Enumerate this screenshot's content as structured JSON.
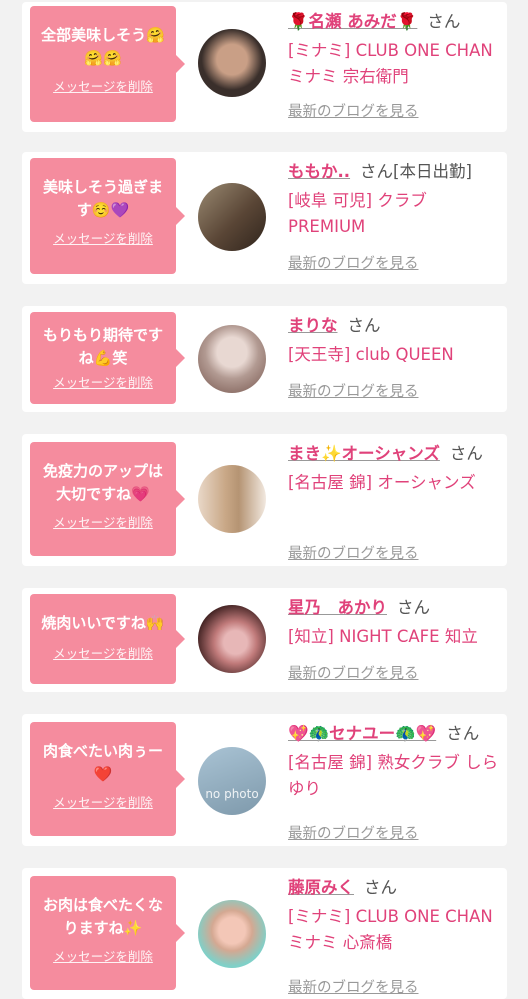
{
  "cards": [
    {
      "message": "全部美味しそう🤗\n🤗🤗",
      "delete_label": "メッセージを削除",
      "name": "🌹名瀬 あみだ🌹",
      "san": "さん",
      "shop": "[ミナミ] CLUB ONE CHAN ミナミ 宗右衛門",
      "blog_label": "最新のブログを見る",
      "avatar_colors": [
        "#3a2f2b",
        "#c99f86"
      ]
    },
    {
      "message": "美味しそう過ぎま\nす☺️💜",
      "delete_label": "メッセージを削除",
      "name": "ももか..",
      "san": "さん[本日出勤]",
      "shop": "[岐阜 可児] クラブ PREMIUM",
      "blog_label": "最新のブログを見る",
      "avatar_colors": [
        "#5a4636",
        "#9a8a72"
      ]
    },
    {
      "message": "もりもり期待です\nね💪笑",
      "delete_label": "メッセージを削除",
      "name": "まりな",
      "san": "さん",
      "shop": "[天王寺] club QUEEN",
      "blog_label": "最新のブログを見る",
      "avatar_colors": [
        "#d7c4bf",
        "#8d7068"
      ]
    },
    {
      "message": "免疫力のアップは\n大切ですね💗",
      "delete_label": "メッセージを削除",
      "name": "まき✨オーシャンズ",
      "san": "さん",
      "shop": "[名古屋 錦] オーシャンズ",
      "blog_label": "最新のブログを見る",
      "avatar_colors": [
        "#e9d8c8",
        "#b59473"
      ]
    },
    {
      "message": "焼肉いいですね🙌",
      "delete_label": "メッセージを削除",
      "name": "星乃　あかり",
      "san": "さん",
      "shop": "[知立] NIGHT CAFE 知立",
      "blog_label": "最新のブログを見る",
      "avatar_colors": [
        "#3b1e1e",
        "#c07a7a"
      ]
    },
    {
      "message": "肉食べたい肉ぅー\n❤️",
      "delete_label": "メッセージを削除",
      "name": "💖🦚セナユー🦚💖",
      "san": "さん",
      "shop": "[名古屋 錦] 熟女クラブ しらゆり",
      "blog_label": "最新のブログを見る",
      "avatar_colors": [
        "#a9c3d4",
        "#7e99ab"
      ],
      "avatar_text": "no photo"
    },
    {
      "message": "お肉は食べたくな\nりますね✨",
      "delete_label": "メッセージを削除",
      "name": "藤原みく",
      "san": "さん",
      "shop": "[ミナミ] CLUB ONE CHAN ミナミ 心斎橋",
      "blog_label": "最新のブログを見る",
      "avatar_colors": [
        "#7fd0c8",
        "#f3c7b7"
      ]
    }
  ]
}
